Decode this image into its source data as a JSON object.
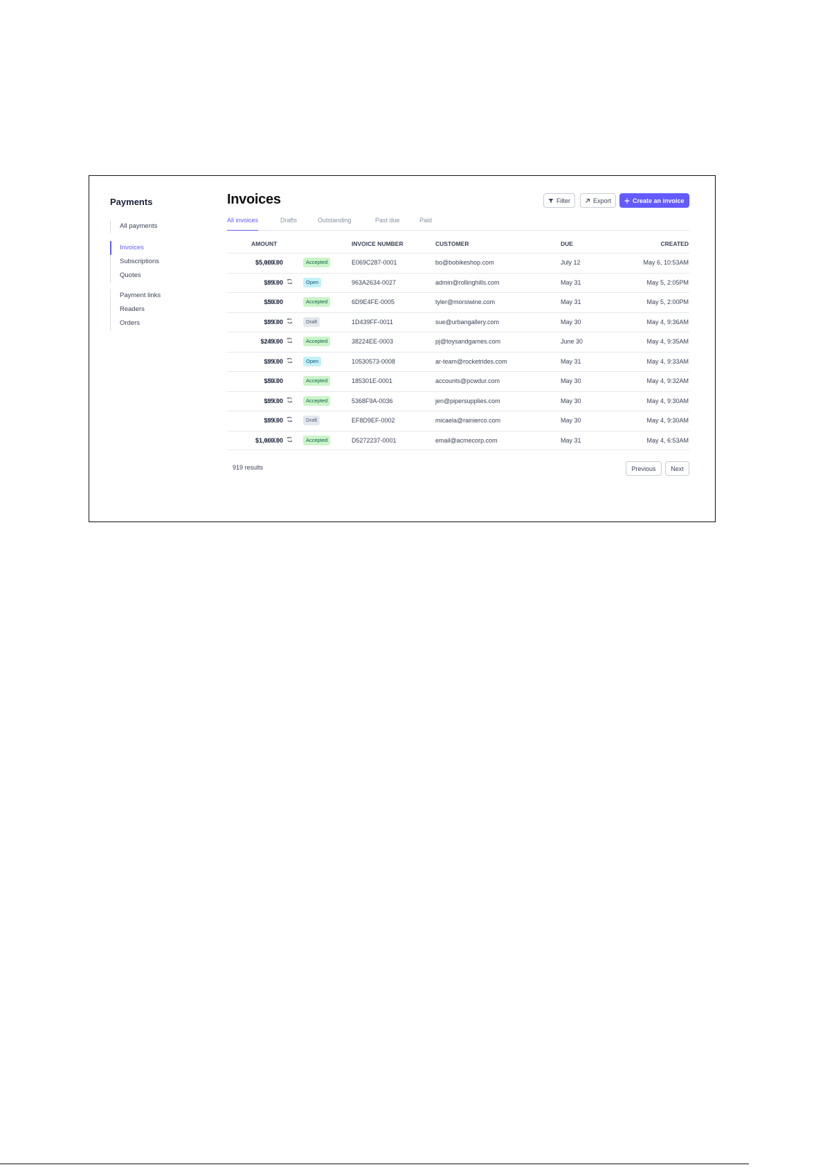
{
  "sidebar": {
    "title": "Payments",
    "group1": [
      "All payments"
    ],
    "group2": [
      "Invoices",
      "Subscriptions",
      "Quotes"
    ],
    "group3": [
      "Payment links",
      "Readers",
      "Orders"
    ],
    "active": "Invoices"
  },
  "header": {
    "title": "Invoices",
    "filter_label": "Filter",
    "export_label": "Export",
    "create_label": "Create an invoice"
  },
  "tabs": [
    "All invoices",
    "Drafts",
    "Outstanding",
    "Past due",
    "Paid"
  ],
  "table": {
    "columns": [
      "AMOUNT",
      "INVOICE NUMBER",
      "CUSTOMER",
      "DUE",
      "CREATED"
    ],
    "rows": [
      {
        "amount": "$5,000.00",
        "currency": "USD",
        "recurring": false,
        "status": "Accepted",
        "invoice": "E069C287-0001",
        "customer": "bo@bobikeshop.com",
        "due": "July 12",
        "created": "May 6, 10:53AM"
      },
      {
        "amount": "$99.00",
        "currency": "USD",
        "recurring": true,
        "status": "Open",
        "invoice": "963A2634-0027",
        "customer": "admin@rollinghills.com",
        "due": "May 31",
        "created": "May 5, 2:05PM"
      },
      {
        "amount": "$50.00",
        "currency": "USD",
        "recurring": false,
        "status": "Accepted",
        "invoice": "6D9E4FE-0005",
        "customer": "tyler@morsiwine.com",
        "due": "May 31",
        "created": "May 5, 2:00PM"
      },
      {
        "amount": "$99.00",
        "currency": "USD",
        "recurring": true,
        "status": "Draft",
        "invoice": "1D439FF-0011",
        "customer": "sue@urbangallery.com",
        "due": "May 30",
        "created": "May 4, 9:36AM"
      },
      {
        "amount": "$249.00",
        "currency": "USD",
        "recurring": true,
        "status": "Accepted",
        "invoice": "38224EE-0003",
        "customer": "pj@toysandgames.com",
        "due": "June 30",
        "created": "May 4, 9:35AM"
      },
      {
        "amount": "$99.00",
        "currency": "USD",
        "recurring": true,
        "status": "Open",
        "invoice": "10530573-0008",
        "customer": "ar-team@rocketrides.com",
        "due": "May 31",
        "created": "May 4, 9:33AM"
      },
      {
        "amount": "$50.00",
        "currency": "USD",
        "recurring": false,
        "status": "Accepted",
        "invoice": "185301E-0001",
        "customer": "accounts@pcwdur.com",
        "due": "May 30",
        "created": "May 4, 9:32AM"
      },
      {
        "amount": "$99.00",
        "currency": "USD",
        "recurring": true,
        "status": "Accepted",
        "invoice": "5368F9A-0036",
        "customer": "jen@pipersupplies.com",
        "due": "May 30",
        "created": "May 4, 9:30AM"
      },
      {
        "amount": "$99.00",
        "currency": "USD",
        "recurring": true,
        "status": "Draft",
        "invoice": "EF8D9EF-0002",
        "customer": "micaela@rainierco.com",
        "due": "May 30",
        "created": "May 4, 9:30AM"
      },
      {
        "amount": "$1,000.00",
        "currency": "USD",
        "recurring": true,
        "status": "Accepted",
        "invoice": "D5272237-0001",
        "customer": "email@acmecorp.com",
        "due": "May 31",
        "created": "May 4, 6:53AM"
      }
    ]
  },
  "footer": {
    "results": "919 results",
    "previous_label": "Previous",
    "next_label": "Next"
  },
  "colors": {
    "accent": "#635bff",
    "accepted_bg": "#cbf4c9",
    "open_bg": "#c4f1f9",
    "draft_bg": "#e3e8ee"
  },
  "icons": {
    "filter": "funnel-icon",
    "export": "arrow-up-right-icon",
    "create": "plus-icon",
    "recurring": "recurring-icon"
  }
}
